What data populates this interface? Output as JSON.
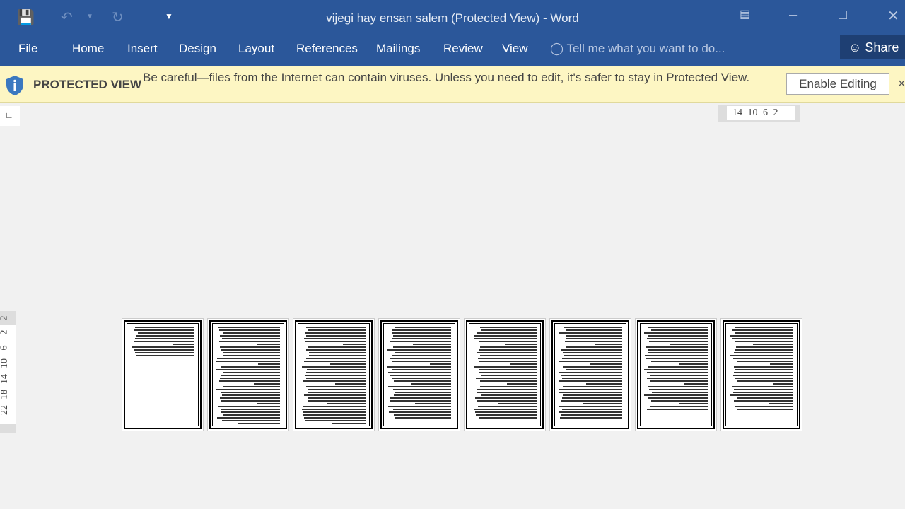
{
  "window": {
    "title": "vijegi hay ensan salem (Protected View) - Word"
  },
  "qat": {
    "save": "save-icon",
    "undo": "undo-icon",
    "redo": "redo-icon",
    "customize": "customize-icon"
  },
  "tabs": [
    "File",
    "Home",
    "Insert",
    "Design",
    "Layout",
    "References",
    "Mailings",
    "Review",
    "View"
  ],
  "tell_me": "Tell me what you want to do...",
  "share": "Share",
  "protected_view": {
    "label": "PROTECTED VIEW",
    "message": "Be careful—files from the Internet can contain viruses. Unless you need to edit, it's safer to stay in Protected View.",
    "button": "Enable Editing",
    "close": "×"
  },
  "horizontal_ruler": "14 10 6 2",
  "vertical_ruler": [
    "2",
    "2",
    "6",
    "10",
    "14",
    "18",
    "22"
  ],
  "pages": [
    {
      "fill": 0.3
    },
    {
      "fill": 1
    },
    {
      "fill": 1
    },
    {
      "fill": 0.95
    },
    {
      "fill": 0.95
    },
    {
      "fill": 0.95
    },
    {
      "fill": 0.85
    },
    {
      "fill": 0.85
    }
  ],
  "colors": {
    "ribbon": "#2b579a",
    "banner": "#fdf6c3"
  }
}
